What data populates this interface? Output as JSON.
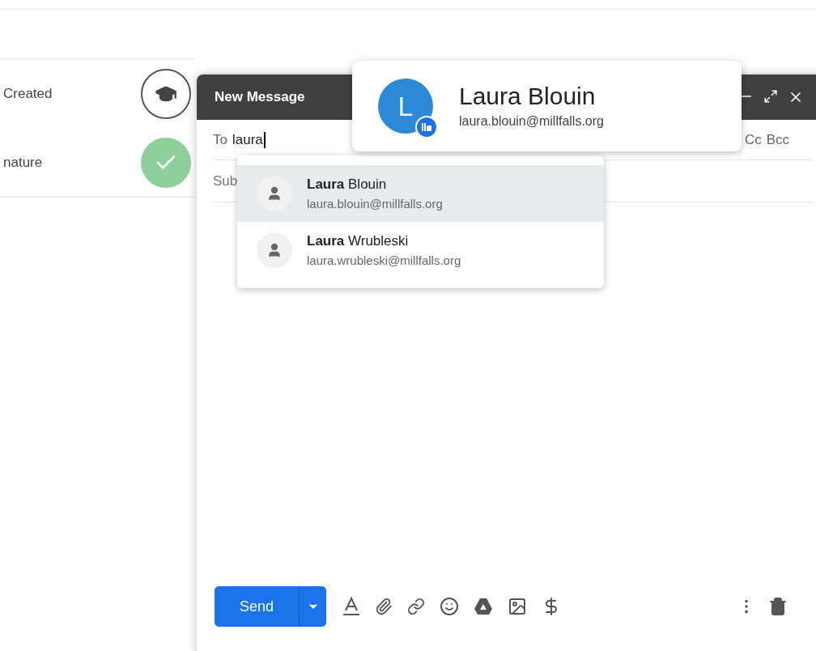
{
  "background_list": [
    {
      "label": "Created",
      "kind": "cap"
    },
    {
      "label": "nature",
      "kind": "done"
    }
  ],
  "compose": {
    "title": "New Message",
    "to_label": "To",
    "to_value": "laura",
    "cc": "Cc",
    "bcc": "Bcc",
    "subject_label": "Sub",
    "send": "Send"
  },
  "suggestions": [
    {
      "name": "**Laura** Blouin",
      "email": "laura.blouin@millfalls.org",
      "selected": true
    },
    {
      "name": "**Laura** Wrubleski",
      "email": "laura.wrubleski@millfalls.org",
      "selected": false
    }
  ],
  "contact_card": {
    "initial": "L",
    "name": "Laura Blouin",
    "email": "laura.blouin@millfalls.org"
  }
}
